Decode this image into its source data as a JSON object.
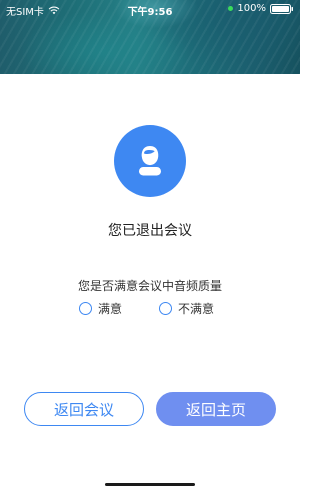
{
  "status_bar": {
    "carrier": "无SIM卡",
    "time": "下午9:56",
    "battery": "100%"
  },
  "avatar": {
    "icon": "user-icon",
    "color": "#3e88f2"
  },
  "title": "您已退出会议",
  "survey": {
    "question": "您是否满意会议中音频质量",
    "options": [
      {
        "label": "满意"
      },
      {
        "label": "不满意"
      }
    ]
  },
  "buttons": {
    "back_to_meeting": "返回会议",
    "back_to_home": "返回主页"
  },
  "colors": {
    "accent": "#3e88f2",
    "primary_button": "#6f8ff0"
  }
}
